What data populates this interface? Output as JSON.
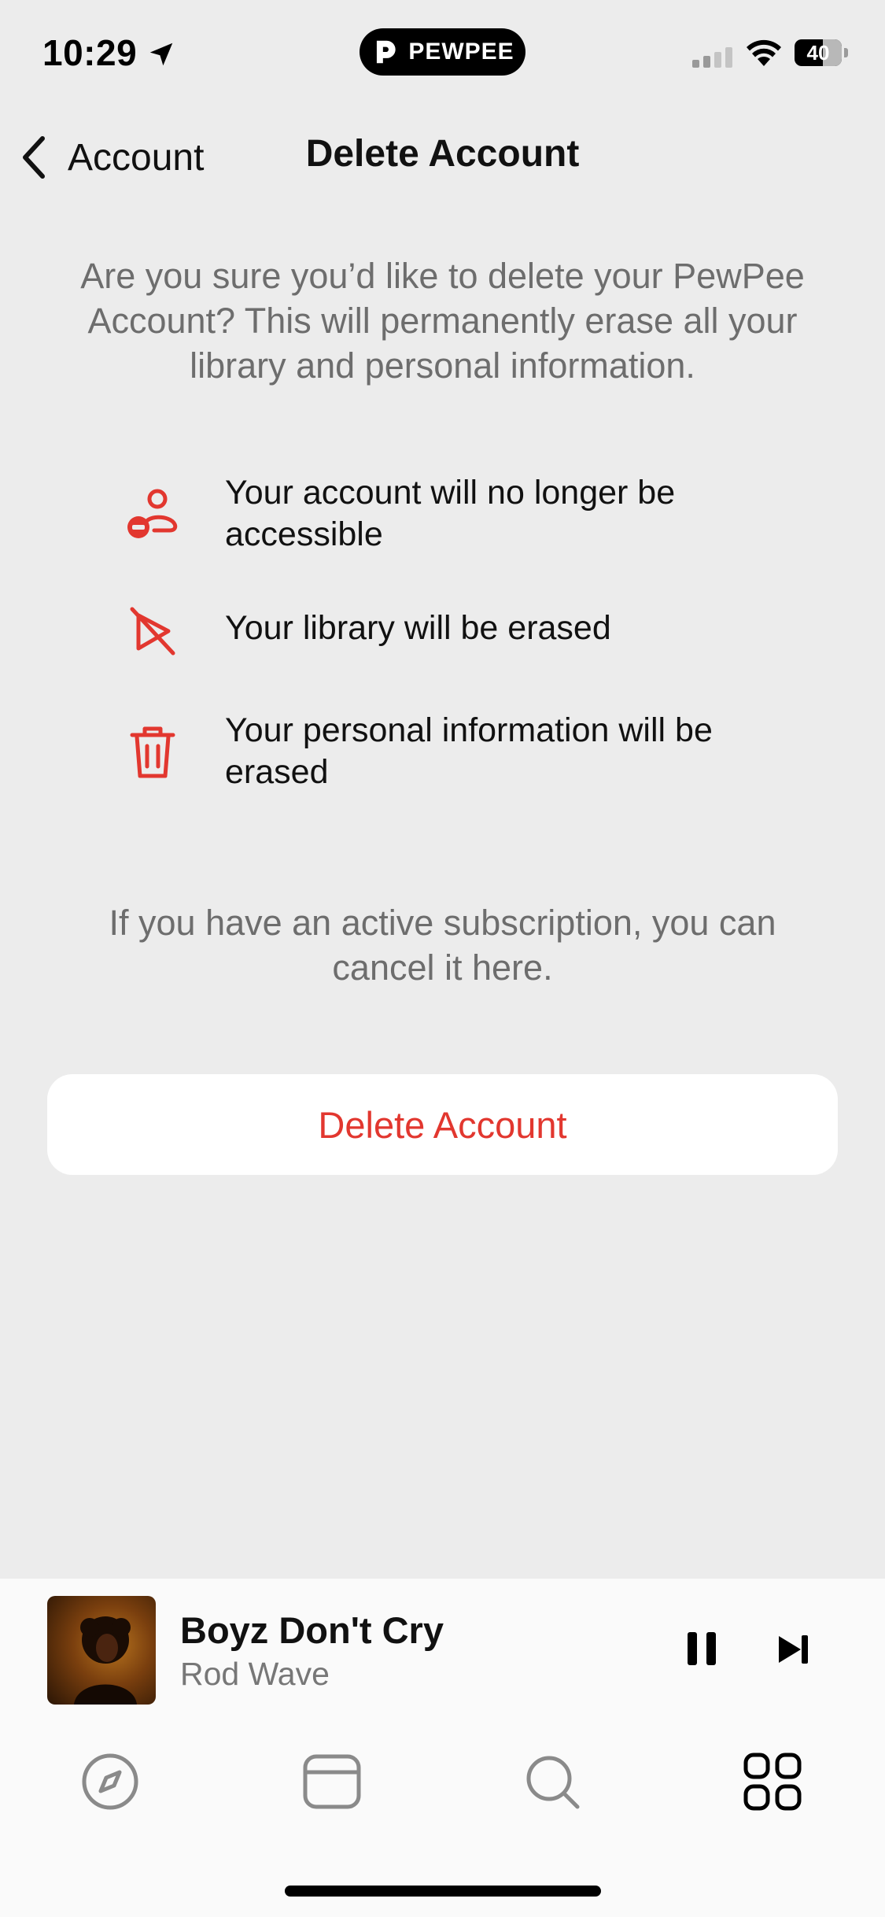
{
  "status_bar": {
    "time": "10:29",
    "brand": "PEWPEE",
    "battery": "40"
  },
  "nav": {
    "back_label": "Account",
    "title": "Delete Account"
  },
  "intro_text": "Are you sure you’d like to delete your PewPee Account? This will permanently erase all your library and personal information.",
  "consequences": [
    {
      "icon": "user-remove-icon",
      "text": "Your account will no longer be accessible"
    },
    {
      "icon": "library-off-icon",
      "text": "Your library will be erased"
    },
    {
      "icon": "trash-icon",
      "text": "Your personal information will be erased"
    }
  ],
  "subscription_note": "If you have an active subscription, you can cancel it here.",
  "delete_button_label": "Delete Account",
  "now_playing": {
    "title": "Boyz Don't Cry",
    "artist": "Rod Wave"
  },
  "tabs": [
    {
      "name": "tab-discover",
      "icon": "compass-icon"
    },
    {
      "name": "tab-radio",
      "icon": "radio-card-icon"
    },
    {
      "name": "tab-search",
      "icon": "search-icon"
    },
    {
      "name": "tab-library",
      "icon": "grid-icon"
    }
  ],
  "colors": {
    "accent": "#e2372f",
    "background": "#ececec",
    "secondary_text": "#6d6d6d"
  }
}
